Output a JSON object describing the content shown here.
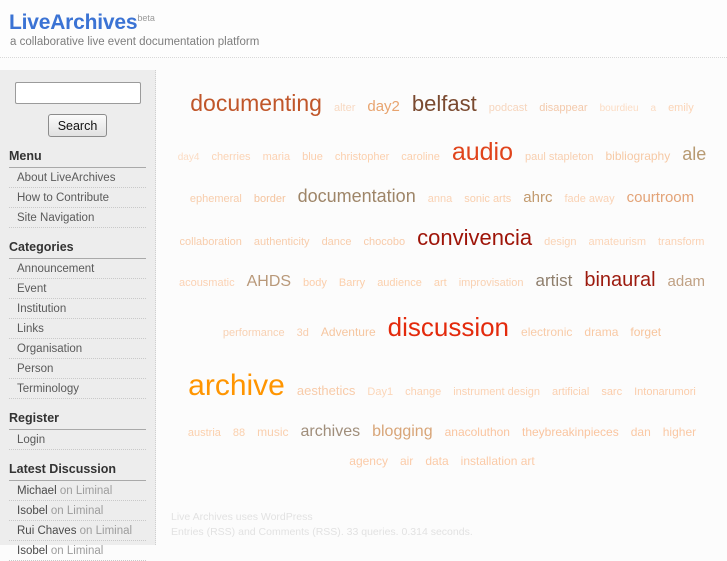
{
  "header": {
    "logo_main": "LiveArchives",
    "logo_beta": "beta",
    "tagline": "a collaborative live event documentation platform",
    "logo_color": "#3b73d4"
  },
  "sidebar": {
    "search": {
      "value": "",
      "placeholder": "",
      "button_label": "Search"
    },
    "sections": [
      {
        "title": "Menu",
        "items": [
          {
            "label": "About LiveArchives"
          },
          {
            "label": "How to Contribute"
          },
          {
            "label": "Site Navigation"
          }
        ]
      },
      {
        "title": "Categories",
        "items": [
          {
            "label": "Announcement"
          },
          {
            "label": "Event"
          },
          {
            "label": "Institution"
          },
          {
            "label": "Links"
          },
          {
            "label": "Organisation"
          },
          {
            "label": "Person"
          },
          {
            "label": "Terminology"
          }
        ]
      },
      {
        "title": "Register",
        "items": [
          {
            "label": "Login"
          }
        ]
      },
      {
        "title": "Latest Discussion",
        "items": [
          {
            "name": "Michael",
            "sep": " on Liminal"
          },
          {
            "name": "Isobel",
            "sep": " on Liminal"
          },
          {
            "name": "Rui Chaves",
            "sep": " on Liminal"
          },
          {
            "name": "Isobel",
            "sep": " on Liminal"
          }
        ]
      }
    ]
  },
  "tagcloud": {
    "tags": [
      {
        "label": "documenting",
        "size": 23,
        "color": "#c0562a"
      },
      {
        "label": "alter",
        "size": 11,
        "color": "#f7d9c2"
      },
      {
        "label": "day2",
        "size": 15,
        "color": "#e8a46f"
      },
      {
        "label": "belfast",
        "size": 22,
        "color": "#7a4a30"
      },
      {
        "label": "podcast",
        "size": 11,
        "color": "#f6d5bd"
      },
      {
        "label": "disappear",
        "size": 11,
        "color": "#f3c9ab"
      },
      {
        "label": "bourdieu",
        "size": 10,
        "color": "#fbdcc4"
      },
      {
        "label": "a",
        "size": 10,
        "color": "#fbdcc4"
      },
      {
        "label": "emily",
        "size": 11,
        "color": "#fbd4b6"
      },
      {
        "label": "day4",
        "size": 10,
        "color": "#fbdcc4"
      },
      {
        "label": "cherries",
        "size": 11,
        "color": "#fbd4b6"
      },
      {
        "label": "maria",
        "size": 11,
        "color": "#fcd2b3"
      },
      {
        "label": "blue",
        "size": 11,
        "color": "#fbcfae"
      },
      {
        "label": "christopher",
        "size": 11,
        "color": "#fbd0ae"
      },
      {
        "label": "caroline",
        "size": 11,
        "color": "#fbd0ae"
      },
      {
        "label": "audio",
        "size": 25,
        "color": "#e0441c"
      },
      {
        "label": "paul stapleton",
        "size": 11,
        "color": "#f8cfb0"
      },
      {
        "label": "bibliography",
        "size": 12,
        "color": "#f6c9a5"
      },
      {
        "label": "ale",
        "size": 18,
        "color": "#b79a72"
      },
      {
        "label": "ephemeral",
        "size": 11,
        "color": "#f7cdac"
      },
      {
        "label": "border",
        "size": 11,
        "color": "#f4c49f"
      },
      {
        "label": "documentation",
        "size": 18,
        "color": "#9e8568"
      },
      {
        "label": "anna",
        "size": 11,
        "color": "#fad2b4"
      },
      {
        "label": "sonic arts",
        "size": 11,
        "color": "#f9cfae"
      },
      {
        "label": "ahrc",
        "size": 15,
        "color": "#c29a6e"
      },
      {
        "label": "fade away",
        "size": 11,
        "color": "#fad3b6"
      },
      {
        "label": "courtroom",
        "size": 15,
        "color": "#e3a377"
      },
      {
        "label": "collaboration",
        "size": 11,
        "color": "#f8cdac"
      },
      {
        "label": "authenticity",
        "size": 11,
        "color": "#f8cdac"
      },
      {
        "label": "dance",
        "size": 11,
        "color": "#f8cdac"
      },
      {
        "label": "chocobo",
        "size": 11,
        "color": "#f8cbaa"
      },
      {
        "label": "convivencia",
        "size": 22,
        "color": "#9e1408"
      },
      {
        "label": "design",
        "size": 11,
        "color": "#fad3b5"
      },
      {
        "label": "amateurism",
        "size": 11,
        "color": "#fbd5b8"
      },
      {
        "label": "transform",
        "size": 11,
        "color": "#fbd2b4"
      },
      {
        "label": "acousmatic",
        "size": 11,
        "color": "#fbd2b4"
      },
      {
        "label": "AHDS",
        "size": 16,
        "color": "#b9997a"
      },
      {
        "label": "body",
        "size": 11,
        "color": "#fbceab"
      },
      {
        "label": "Barry",
        "size": 11,
        "color": "#fbcfab"
      },
      {
        "label": "audience",
        "size": 11,
        "color": "#fbd0ad"
      },
      {
        "label": "art",
        "size": 11,
        "color": "#fbd0ad"
      },
      {
        "label": "improvisation",
        "size": 11,
        "color": "#f9d1b2"
      },
      {
        "label": "artist",
        "size": 17,
        "color": "#8f7f6d"
      },
      {
        "label": "binaural",
        "size": 20,
        "color": "#9c1a0e"
      },
      {
        "label": "adam",
        "size": 15,
        "color": "#c0a184"
      },
      {
        "label": "performance",
        "size": 11,
        "color": "#f8d1b3"
      },
      {
        "label": "3d",
        "size": 11,
        "color": "#f8cdad"
      },
      {
        "label": "Adventure",
        "size": 12,
        "color": "#f6c6a0"
      },
      {
        "label": "discussion",
        "size": 26,
        "color": "#e32a0c"
      },
      {
        "label": "electronic",
        "size": 12,
        "color": "#f8cba8"
      },
      {
        "label": "drama",
        "size": 12,
        "color": "#f9c9a4"
      },
      {
        "label": "forget",
        "size": 12,
        "color": "#f7c49c"
      },
      {
        "label": "archive",
        "size": 30,
        "color": "#ff9500"
      },
      {
        "label": "aesthetics",
        "size": 13,
        "color": "#f8cba9"
      },
      {
        "label": "Day1",
        "size": 11,
        "color": "#fbd6b9"
      },
      {
        "label": "change",
        "size": 11,
        "color": "#fbd2b3"
      },
      {
        "label": "instrument design",
        "size": 11,
        "color": "#fbd2b3"
      },
      {
        "label": "artificial",
        "size": 11,
        "color": "#fbd0b0"
      },
      {
        "label": "sarc",
        "size": 11,
        "color": "#fbcdab"
      },
      {
        "label": "Intonarumori",
        "size": 11,
        "color": "#fbcdab"
      },
      {
        "label": "austria",
        "size": 11,
        "color": "#fbd0ad"
      },
      {
        "label": "88",
        "size": 11,
        "color": "#fbd0ad"
      },
      {
        "label": "music",
        "size": 12,
        "color": "#f9cfae"
      },
      {
        "label": "archives",
        "size": 16,
        "color": "#a08e7b"
      },
      {
        "label": "blogging",
        "size": 16,
        "color": "#d8a578"
      },
      {
        "label": "anacoluthon",
        "size": 12,
        "color": "#fac5a0"
      },
      {
        "label": "theybreakinpieces",
        "size": 12,
        "color": "#fac5a0"
      },
      {
        "label": "dan",
        "size": 12,
        "color": "#fac8a4"
      },
      {
        "label": "higher",
        "size": 12,
        "color": "#fac8a4"
      },
      {
        "label": "agency",
        "size": 12,
        "color": "#fbcba8"
      },
      {
        "label": "air",
        "size": 12,
        "color": "#fbcba8"
      },
      {
        "label": "data",
        "size": 12,
        "color": "#fbcba8"
      },
      {
        "label": "installation art",
        "size": 12,
        "color": "#fbcba8"
      }
    ]
  },
  "footer": {
    "line1": "Live Archives uses WordPress",
    "line2_pre": "Entries (RSS)",
    "line2_mid": " and ",
    "line2_post": "Comments (RSS)",
    "line2_stats": ". 33 queries. 0.314 seconds."
  }
}
